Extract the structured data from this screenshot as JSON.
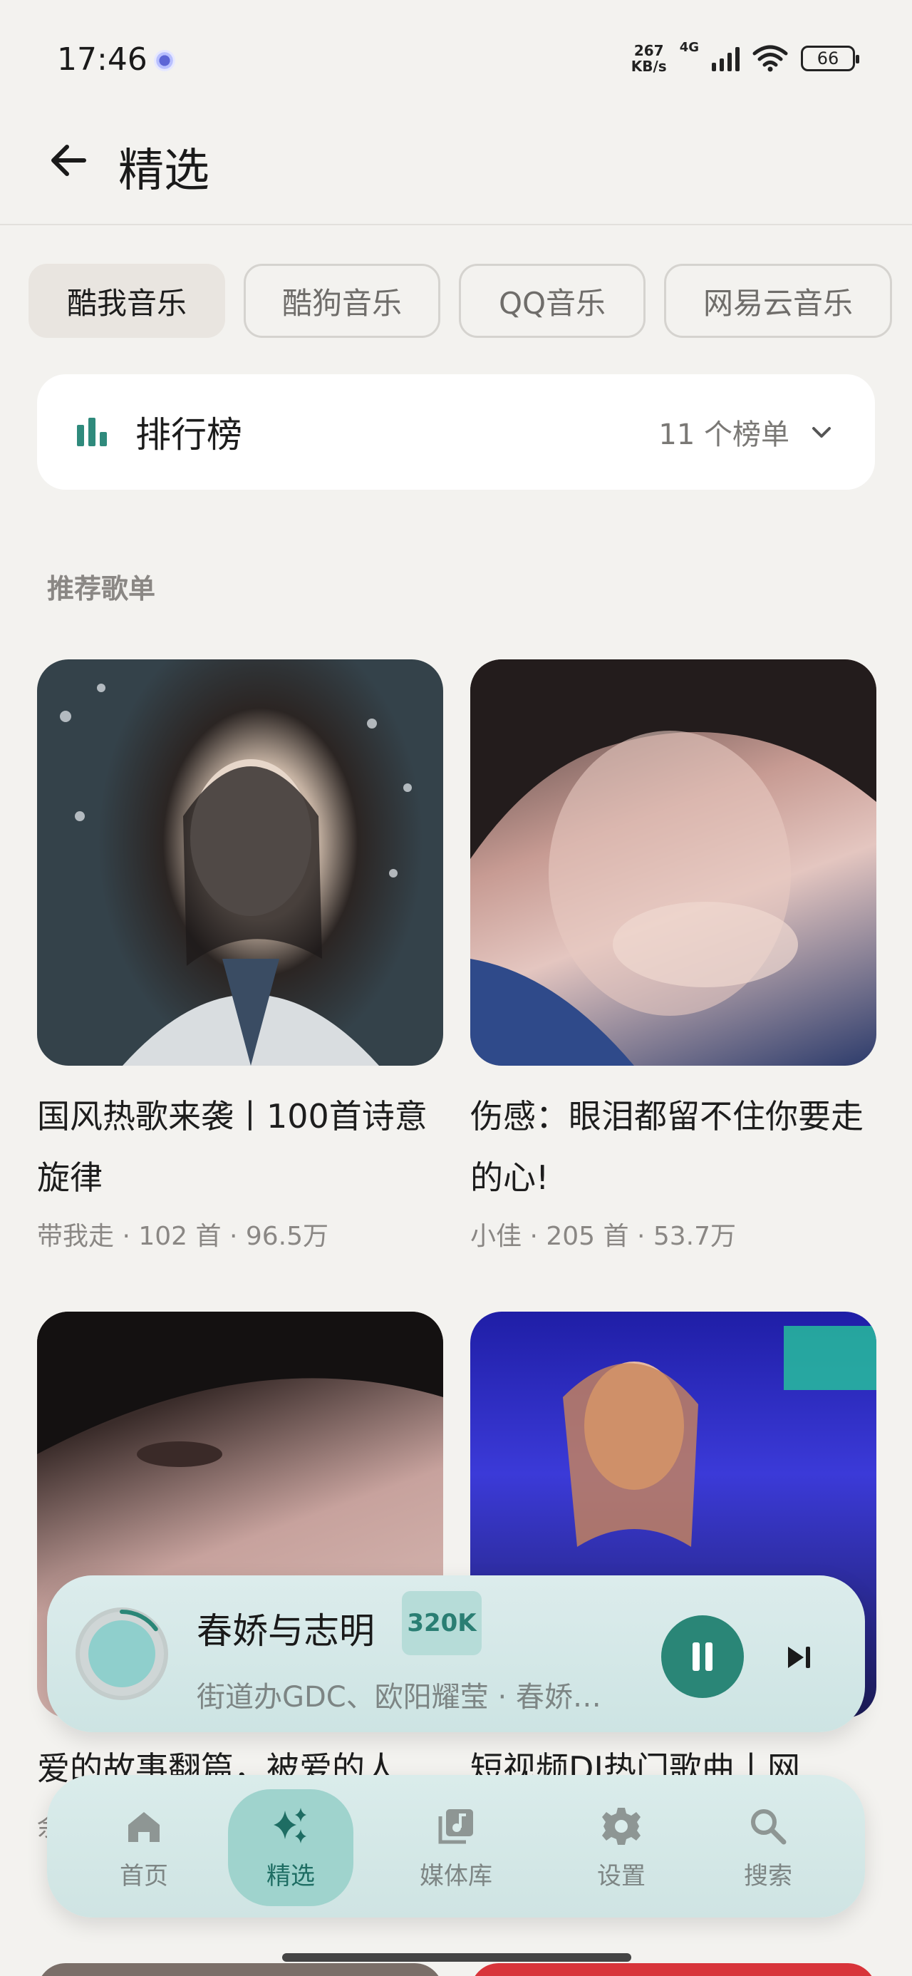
{
  "status_bar": {
    "time": "17:46",
    "net_speed_value": "267",
    "net_speed_unit": "KB/s",
    "network": "4G",
    "battery": "66"
  },
  "header": {
    "title": "精选"
  },
  "sources": [
    {
      "label": "酷我音乐",
      "active": true
    },
    {
      "label": "酷狗音乐",
      "active": false
    },
    {
      "label": "QQ音乐",
      "active": false
    },
    {
      "label": "网易云音乐",
      "active": false
    }
  ],
  "ranking": {
    "title": "排行榜",
    "count": "11 个榜单"
  },
  "section": {
    "title": "推荐歌单"
  },
  "playlists": [
    {
      "title": "国风热歌来袭丨100首诗意旋律",
      "creator": "带我走",
      "tracks": "102 首",
      "plays": "96.5万",
      "cover_color": "#3d4a52"
    },
    {
      "title": "伤感：眼泪都留不住你要走的心!",
      "creator": "小佳",
      "tracks": "205 首",
      "plays": "53.7万",
      "cover_color": "#6b5550"
    },
    {
      "title": "爱的故事翻篇，被爱的人",
      "creator": "余",
      "tracks": "",
      "plays": "",
      "cover_color": "#caa6a0"
    },
    {
      "title": "短视频DJ热门歌曲丨网",
      "creator": "",
      "tracks": "",
      "plays": "",
      "cover_color": "#2a2f9a"
    }
  ],
  "player": {
    "song": "春娇与志明",
    "quality": "320K",
    "artist": "街道办GDC、欧阳耀莹 · 春娇…",
    "progress": 0.15,
    "accent": "#2a8677"
  },
  "nav": [
    {
      "label": "首页",
      "icon": "home-icon",
      "active": false
    },
    {
      "label": "精选",
      "icon": "sparkle-icon",
      "active": true
    },
    {
      "label": "媒体库",
      "icon": "library-icon",
      "active": false
    },
    {
      "label": "设置",
      "icon": "gear-icon",
      "active": false
    },
    {
      "label": "搜索",
      "icon": "search-icon",
      "active": false
    }
  ]
}
